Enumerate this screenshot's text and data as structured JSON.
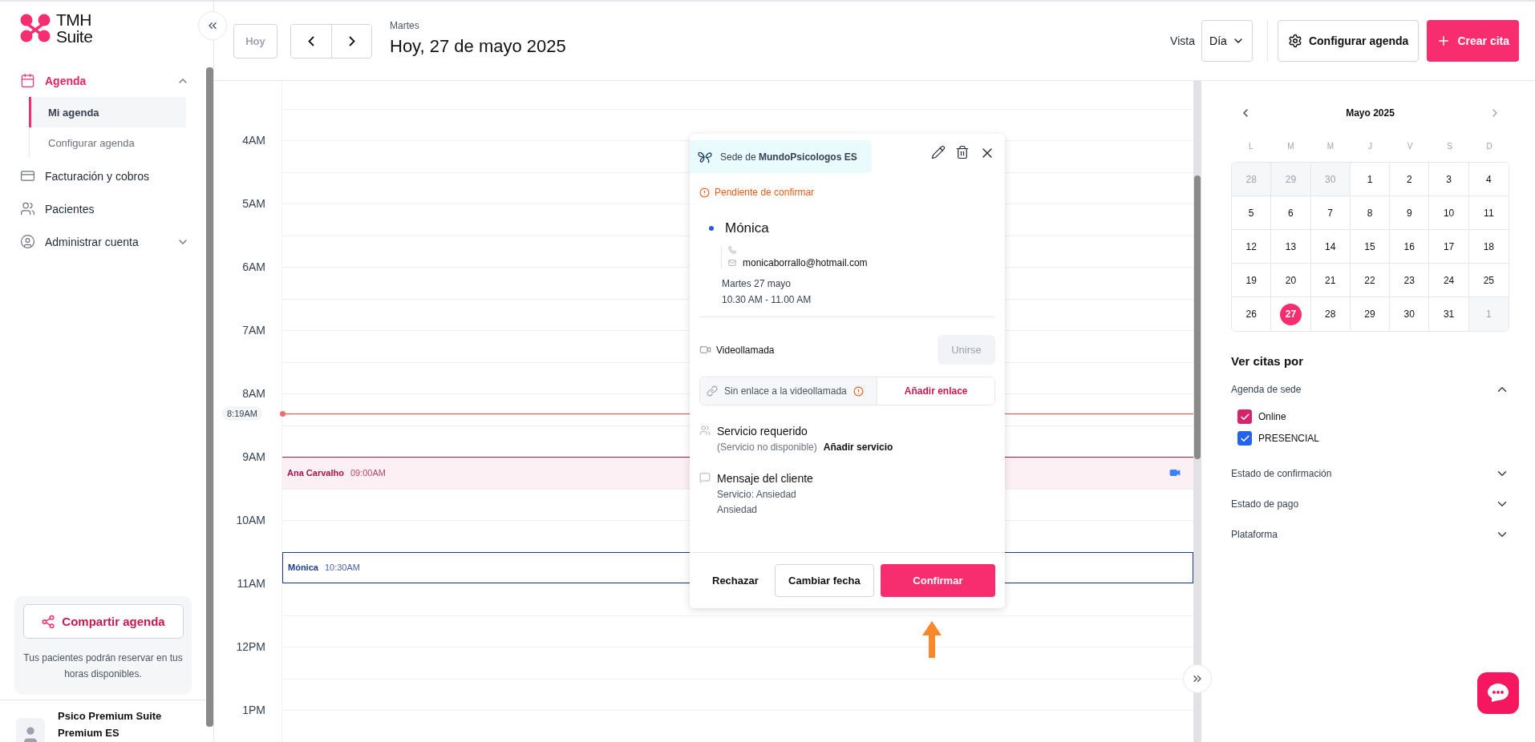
{
  "sidebar": {
    "logo": [
      "TMH",
      "Suite"
    ],
    "nav": [
      {
        "label": "Agenda",
        "selected": true,
        "expanded": true,
        "children": [
          {
            "label": "Mi agenda",
            "selected": true
          },
          {
            "label": "Configurar agenda",
            "selected": false
          }
        ]
      },
      {
        "label": "Facturación y cobros",
        "selected": false
      },
      {
        "label": "Pacientes",
        "selected": false
      },
      {
        "label": "Administrar cuenta",
        "selected": false,
        "expanded": false
      }
    ],
    "share": {
      "button": "Compartir agenda",
      "text": "Tus pacientes podrán reservar en tus horas disponibles."
    },
    "user": {
      "name": "Psico Premium Suite",
      "plan": "Premium ES"
    }
  },
  "header": {
    "today_button": {
      "label": "Hoy",
      "disabled": true
    },
    "weekday": "Martes",
    "date": "Hoy, 27 de mayo 2025",
    "view_label": "Vista",
    "view_value": "Día",
    "config_button": "Configurar agenda",
    "create_button": "Crear cita"
  },
  "schedule": {
    "hours": [
      "4AM",
      "5AM",
      "6AM",
      "7AM",
      "8AM",
      "9AM",
      "10AM",
      "11AM",
      "12PM",
      "1PM"
    ],
    "now": "8:19AM",
    "events": [
      {
        "name": "Ana Carvalho",
        "time": "09:00AM",
        "color": "#a3174a",
        "video": true
      },
      {
        "name": "Mónica",
        "time": "10:30AM",
        "color": "#1e3a8a",
        "video": false
      }
    ]
  },
  "appointment": {
    "location": "Sede de **MundoPsicologos ES**",
    "status": "Pendiente de confirmar",
    "client": "Mónica",
    "email": "monicaborrallo@hotmail.com",
    "date": "Martes 27 mayo",
    "time": "10.30 AM - 11.00 AM",
    "video_label": "Videollamada",
    "join_button": {
      "label": "Unirse",
      "disabled": true
    },
    "link_status": "Sin enlace a la videollamada",
    "add_link": "Añadir enlace",
    "service_title": "Servicio requerido",
    "service_status": "(Servicio no disponible)",
    "add_service": "Añadir servicio",
    "message_title": "Mensaje del cliente",
    "message_lines": [
      "Servicio: Ansiedad",
      "Ansiedad"
    ],
    "actions": {
      "reject": "Rechazar",
      "reschedule": "Cambiar fecha",
      "confirm": "Confirmar"
    }
  },
  "mini_calendar": {
    "title": "Mayo 2025",
    "weekdays": [
      "L",
      "M",
      "M",
      "J",
      "V",
      "S",
      "D"
    ],
    "weeks": [
      [
        {
          "day": "28",
          "muted": true,
          "selected": false
        },
        {
          "day": "29",
          "muted": true,
          "selected": false
        },
        {
          "day": "30",
          "muted": true,
          "selected": false
        },
        {
          "day": "1",
          "muted": false,
          "selected": false
        },
        {
          "day": "2",
          "muted": false,
          "selected": false
        },
        {
          "day": "3",
          "muted": false,
          "selected": false
        },
        {
          "day": "4",
          "muted": false,
          "selected": false
        }
      ],
      [
        {
          "day": "5",
          "muted": false,
          "selected": false
        },
        {
          "day": "6",
          "muted": false,
          "selected": false
        },
        {
          "day": "7",
          "muted": false,
          "selected": false
        },
        {
          "day": "8",
          "muted": false,
          "selected": false
        },
        {
          "day": "9",
          "muted": false,
          "selected": false
        },
        {
          "day": "10",
          "muted": false,
          "selected": false
        },
        {
          "day": "11",
          "muted": false,
          "selected": false
        }
      ],
      [
        {
          "day": "12",
          "muted": false,
          "selected": false
        },
        {
          "day": "13",
          "muted": false,
          "selected": false
        },
        {
          "day": "14",
          "muted": false,
          "selected": false
        },
        {
          "day": "15",
          "muted": false,
          "selected": false
        },
        {
          "day": "16",
          "muted": false,
          "selected": false
        },
        {
          "day": "17",
          "muted": false,
          "selected": false
        },
        {
          "day": "18",
          "muted": false,
          "selected": false
        }
      ],
      [
        {
          "day": "19",
          "muted": false,
          "selected": false
        },
        {
          "day": "20",
          "muted": false,
          "selected": false
        },
        {
          "day": "21",
          "muted": false,
          "selected": false
        },
        {
          "day": "22",
          "muted": false,
          "selected": false
        },
        {
          "day": "23",
          "muted": false,
          "selected": false
        },
        {
          "day": "24",
          "muted": false,
          "selected": false
        },
        {
          "day": "25",
          "muted": false,
          "selected": false
        }
      ],
      [
        {
          "day": "26",
          "muted": false,
          "selected": false
        },
        {
          "day": "27",
          "muted": false,
          "selected": true
        },
        {
          "day": "28",
          "muted": false,
          "selected": false
        },
        {
          "day": "29",
          "muted": false,
          "selected": false
        },
        {
          "day": "30",
          "muted": false,
          "selected": false
        },
        {
          "day": "31",
          "muted": false,
          "selected": false
        },
        {
          "day": "1",
          "muted": true,
          "selected": false
        }
      ]
    ]
  },
  "filters": {
    "title": "Ver citas por",
    "groups": [
      {
        "label": "Agenda de sede",
        "expanded": true,
        "options": [
          {
            "label": "Online",
            "checked": true,
            "color": "#d6246b"
          },
          {
            "label": "PRESENCIAL",
            "checked": true,
            "color": "#2563eb"
          }
        ]
      },
      {
        "label": "Estado de confirmación",
        "expanded": false
      },
      {
        "label": "Estado de pago",
        "expanded": false
      },
      {
        "label": "Plataforma",
        "expanded": false
      }
    ]
  }
}
